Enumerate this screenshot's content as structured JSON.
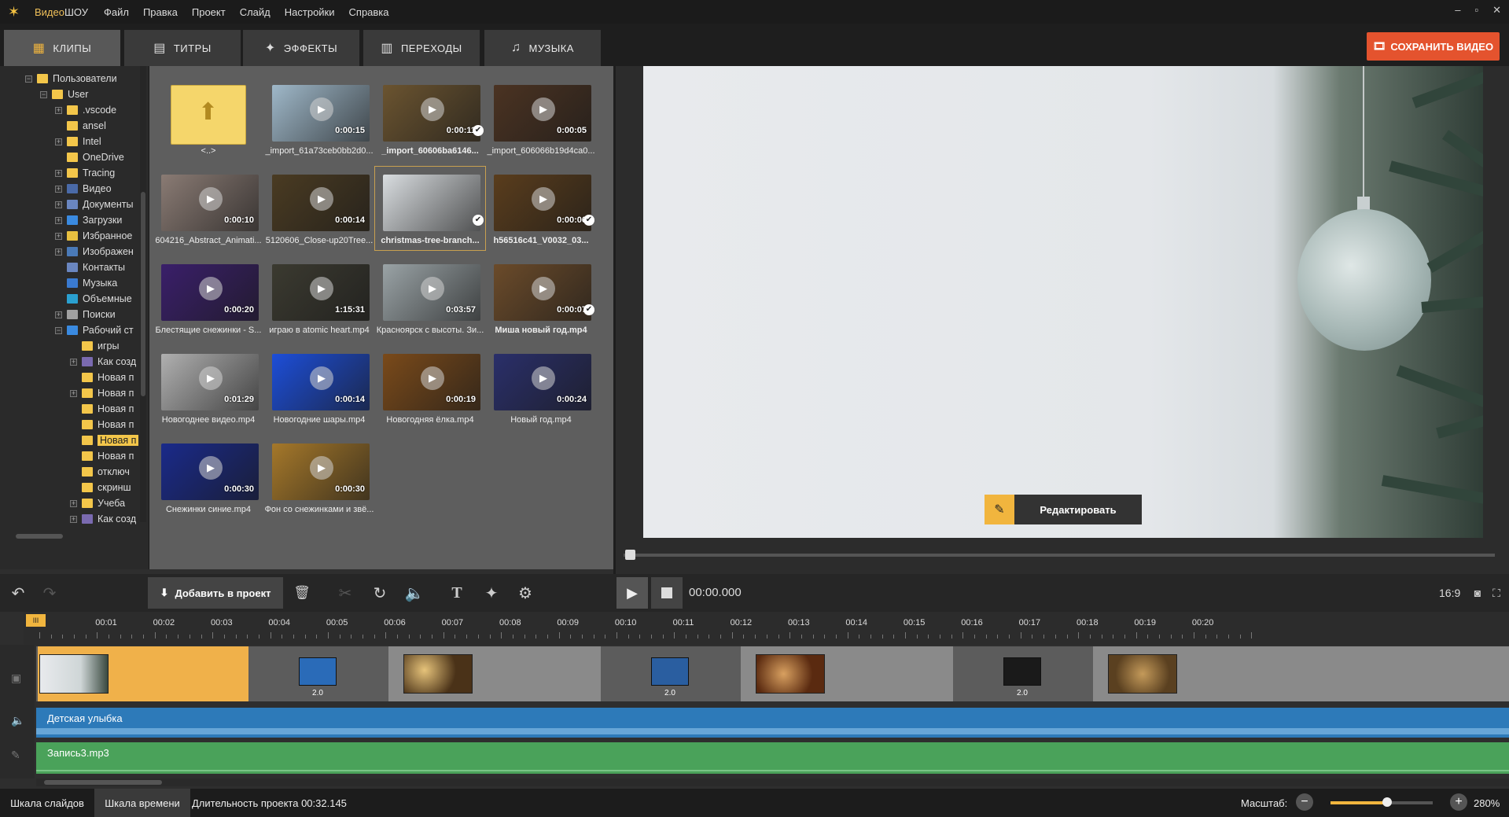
{
  "app": {
    "name_prefix": "Видео",
    "name_suffix": "ШОУ"
  },
  "menu": [
    "Файл",
    "Правка",
    "Проект",
    "Слайд",
    "Настройки",
    "Справка"
  ],
  "window_controls": [
    "–",
    "▫",
    "✕"
  ],
  "tabs": [
    {
      "label": "КЛИПЫ",
      "icon": "clips-icon",
      "active": true
    },
    {
      "label": "ТИТРЫ",
      "icon": "titles-icon",
      "active": false
    },
    {
      "label": "ЭФФЕКТЫ",
      "icon": "effects-icon",
      "active": false
    },
    {
      "label": "ПЕРЕХОДЫ",
      "icon": "transitions-icon",
      "active": false
    },
    {
      "label": "МУЗЫКА",
      "icon": "music-icon",
      "active": false
    }
  ],
  "save_button": "СОХРАНИТЬ ВИДЕО",
  "tree": [
    {
      "label": "Пользователи",
      "level": 0,
      "exp": "−"
    },
    {
      "label": "User",
      "level": 1,
      "exp": "−"
    },
    {
      "label": ".vscode",
      "level": 2,
      "exp": "+"
    },
    {
      "label": "ansel",
      "level": 2,
      "exp": ""
    },
    {
      "label": "Intel",
      "level": 2,
      "exp": "+"
    },
    {
      "label": "OneDrive",
      "level": 2,
      "exp": ""
    },
    {
      "label": "Tracing",
      "level": 2,
      "exp": "+"
    },
    {
      "label": "Видео",
      "level": 2,
      "exp": "+"
    },
    {
      "label": "Документы",
      "level": 2,
      "exp": "+"
    },
    {
      "label": "Загрузки",
      "level": 2,
      "exp": "+"
    },
    {
      "label": "Избранное",
      "level": 2,
      "exp": "+"
    },
    {
      "label": "Изображен",
      "level": 2,
      "exp": "+"
    },
    {
      "label": "Контакты",
      "level": 2,
      "exp": ""
    },
    {
      "label": "Музыка",
      "level": 2,
      "exp": ""
    },
    {
      "label": "Объемные",
      "level": 2,
      "exp": ""
    },
    {
      "label": "Поиски",
      "level": 2,
      "exp": "+"
    },
    {
      "label": "Рабочий ст",
      "level": 2,
      "exp": "−"
    },
    {
      "label": "игры",
      "level": 3,
      "exp": ""
    },
    {
      "label": "Как созд",
      "level": 3,
      "exp": "+"
    },
    {
      "label": "Новая п",
      "level": 3,
      "exp": ""
    },
    {
      "label": "Новая п",
      "level": 3,
      "exp": "+"
    },
    {
      "label": "Новая п",
      "level": 3,
      "exp": ""
    },
    {
      "label": "Новая п",
      "level": 3,
      "exp": ""
    },
    {
      "label": "Новая п",
      "level": 3,
      "exp": "",
      "selected": true
    },
    {
      "label": "Новая п",
      "level": 3,
      "exp": ""
    },
    {
      "label": "отключ",
      "level": 3,
      "exp": ""
    },
    {
      "label": "скринш",
      "level": 3,
      "exp": ""
    },
    {
      "label": "Учеба",
      "level": 3,
      "exp": "+"
    },
    {
      "label": "Как созд",
      "level": 3,
      "exp": "+"
    }
  ],
  "clips": [
    {
      "name": "<..>",
      "duration": "",
      "folder": true,
      "color": "#f5d66b"
    },
    {
      "name": "_import_61a73ceb0bb2d0...",
      "duration": "0:00:15",
      "color": "#9fb8c9"
    },
    {
      "name": "_import_60606ba6146...",
      "duration": "0:00:11",
      "color": "#6b5430",
      "bold": true,
      "check": true
    },
    {
      "name": "_import_606066b19d4ca0...",
      "duration": "0:00:05",
      "color": "#4b3322"
    },
    {
      "name": "604216_Abstract_Animati...",
      "duration": "0:00:10",
      "color": "#8a7b74"
    },
    {
      "name": "5120606_Close-up20Tree...",
      "duration": "0:00:14",
      "color": "#4a3b22"
    },
    {
      "name": "christmas-tree-branch...",
      "duration": "",
      "color": "#d9dde0",
      "bold": true,
      "check": true,
      "selected": true
    },
    {
      "name": "h56516c41_V0032_03...",
      "duration": "0:00:06",
      "color": "#5a3d1c",
      "bold": true,
      "check": true
    },
    {
      "name": "Блестящие снежинки - S...",
      "duration": "0:00:20",
      "color": "#3a1f6a"
    },
    {
      "name": "играю в atomic heart.mp4",
      "duration": "1:15:31",
      "color": "#3b3a30"
    },
    {
      "name": "Красноярск с высоты. Зи...",
      "duration": "0:03:57",
      "color": "#9aa3a6"
    },
    {
      "name": "Миша новый год.mp4",
      "duration": "0:00:07",
      "color": "#6b4b2a",
      "bold": true,
      "check": true
    },
    {
      "name": "Новогоднее видео.mp4",
      "duration": "0:01:29",
      "color": "#b0b0b0"
    },
    {
      "name": "Новогодние шары.mp4",
      "duration": "0:00:14",
      "color": "#1d4ed8"
    },
    {
      "name": "Новогодняя ёлка.mp4",
      "duration": "0:00:19",
      "color": "#7a4a1a"
    },
    {
      "name": "Новый год.mp4",
      "duration": "0:00:24",
      "color": "#2a2f6a"
    },
    {
      "name": "Снежинки синие.mp4",
      "duration": "0:00:30",
      "color": "#1a2a8a"
    },
    {
      "name": "Фон со снежинками и звё...",
      "duration": "0:00:30",
      "color": "#a5782a"
    }
  ],
  "edit_button": "Редактировать",
  "toolbar": {
    "add_to_project": "Добавить в проект",
    "timecode": "00:00.000",
    "ratio": "16:9"
  },
  "ruler_labels": [
    "00:01",
    "00:02",
    "00:03",
    "00:04",
    "00:05",
    "00:06",
    "00:07",
    "00:08",
    "00:09",
    "00:10",
    "00:11",
    "00:12",
    "00:13",
    "00:14",
    "00:15",
    "00:16",
    "00:17",
    "00:18",
    "00:19",
    "00:20"
  ],
  "playhead_label": "III",
  "transitions": [
    {
      "label": "2.0",
      "color": "#2a6bb8"
    },
    {
      "label": "2.0",
      "color": "#2a5ea0"
    },
    {
      "label": "2.0",
      "color": "#1a1a1a"
    }
  ],
  "audio_tracks": [
    {
      "name": "Детская улыбка"
    },
    {
      "name": "Запись3.mp3"
    }
  ],
  "status": {
    "tab_slides": "Шкала слайдов",
    "tab_timeline": "Шкала времени",
    "duration": "Длительность проекта 00:32.145",
    "zoom_label": "Масштаб:",
    "zoom_value": "280%",
    "zoom_level": 0.55
  }
}
